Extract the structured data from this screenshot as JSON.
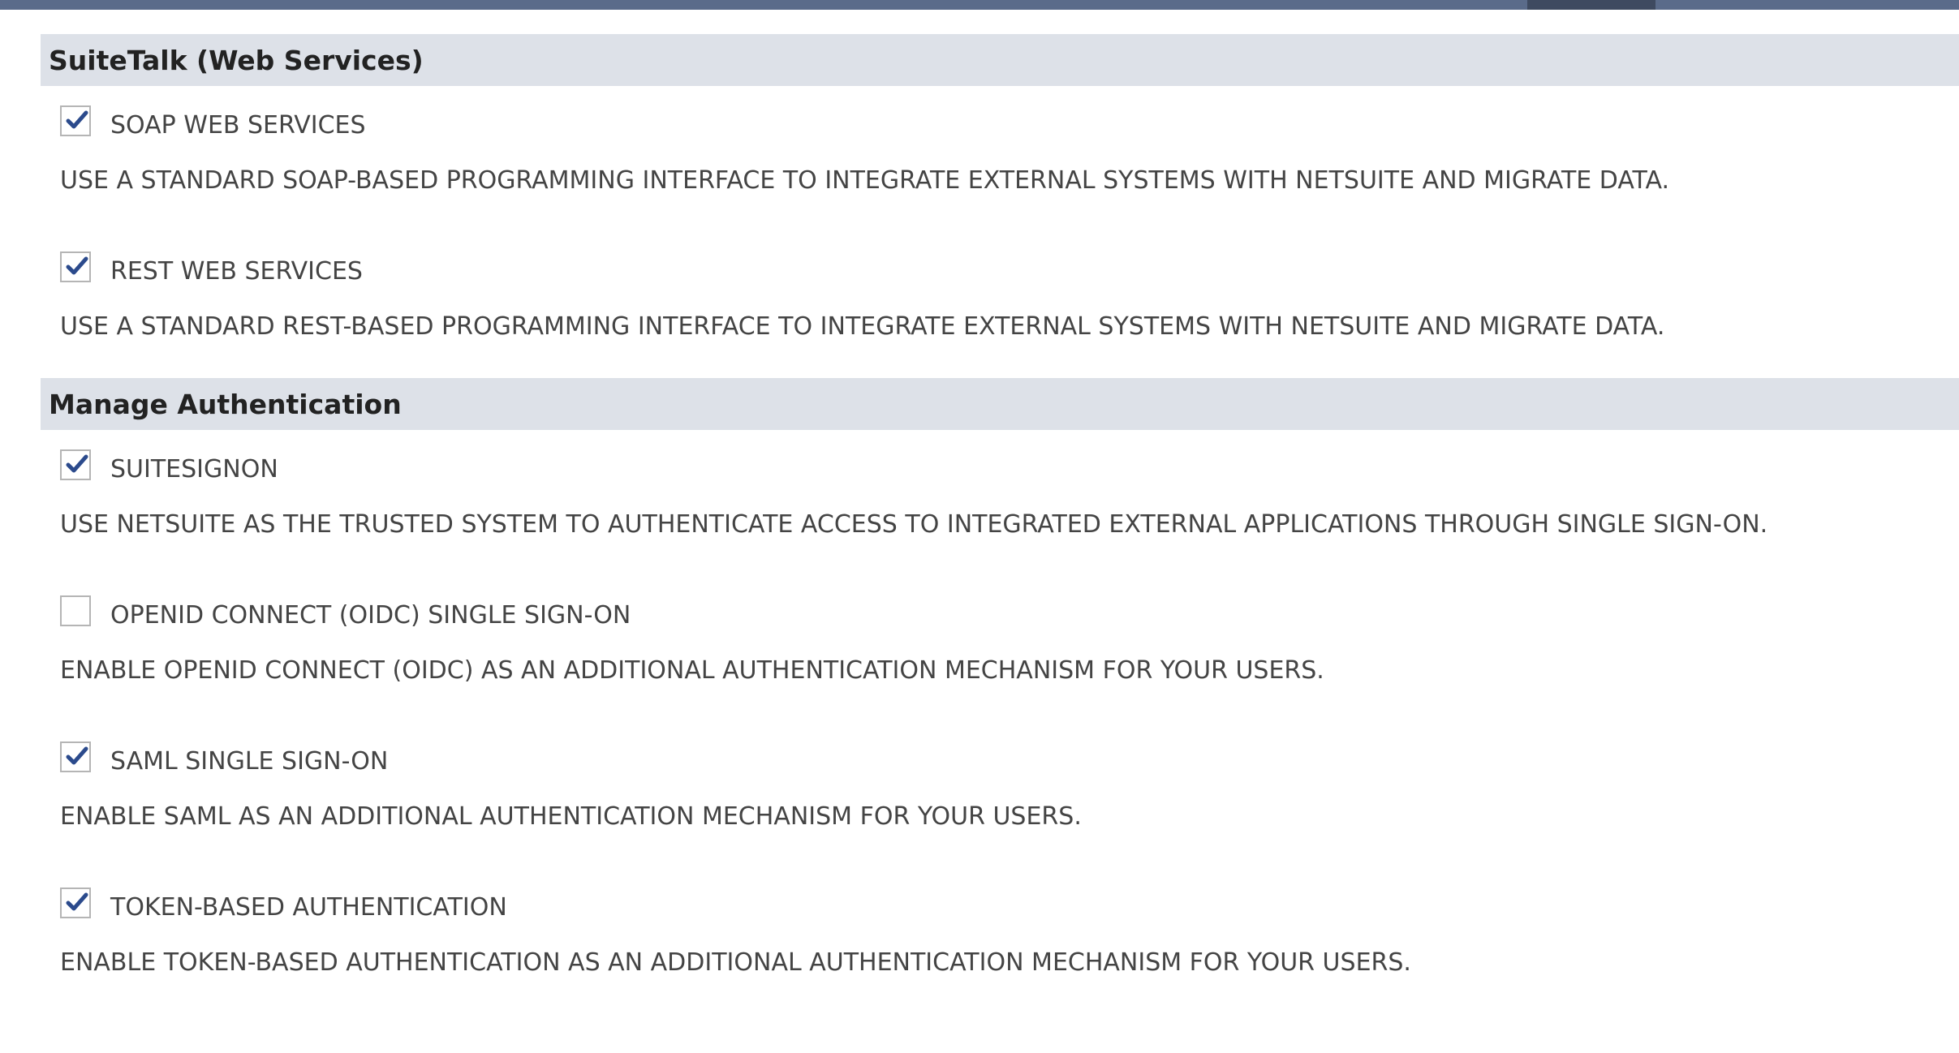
{
  "sections": [
    {
      "title": "SuiteTalk (Web Services)",
      "options": [
        {
          "label": "SOAP WEB SERVICES",
          "checked": true,
          "description": "USE A STANDARD SOAP-BASED PROGRAMMING INTERFACE TO INTEGRATE EXTERNAL SYSTEMS WITH NETSUITE AND MIGRATE DATA."
        },
        {
          "label": "REST WEB SERVICES",
          "checked": true,
          "description": "USE A STANDARD REST-BASED PROGRAMMING INTERFACE TO INTEGRATE EXTERNAL SYSTEMS WITH NETSUITE AND MIGRATE DATA."
        }
      ]
    },
    {
      "title": "Manage Authentication",
      "options": [
        {
          "label": "SUITESIGNON",
          "checked": true,
          "description": "USE NETSUITE AS THE TRUSTED SYSTEM TO AUTHENTICATE ACCESS TO INTEGRATED EXTERNAL APPLICATIONS THROUGH SINGLE SIGN-ON."
        },
        {
          "label": "OPENID CONNECT (OIDC) SINGLE SIGN-ON",
          "checked": false,
          "description": "ENABLE OPENID CONNECT (OIDC) AS AN ADDITIONAL AUTHENTICATION MECHANISM FOR YOUR USERS."
        },
        {
          "label": "SAML SINGLE SIGN-ON",
          "checked": true,
          "description": "ENABLE SAML AS AN ADDITIONAL AUTHENTICATION MECHANISM FOR YOUR USERS."
        },
        {
          "label": "TOKEN-BASED AUTHENTICATION",
          "checked": true,
          "description": "ENABLE TOKEN-BASED AUTHENTICATION AS AN ADDITIONAL AUTHENTICATION MECHANISM FOR YOUR USERS."
        }
      ]
    }
  ],
  "colors": {
    "top_bar": "#5a6b8a",
    "top_bar_active_tab": "#3e4a60",
    "section_header_bg": "#dde1e8",
    "checkmark": "#2b4a8c",
    "text": "#444444"
  },
  "icons": {
    "checked": "checkmark-icon"
  }
}
